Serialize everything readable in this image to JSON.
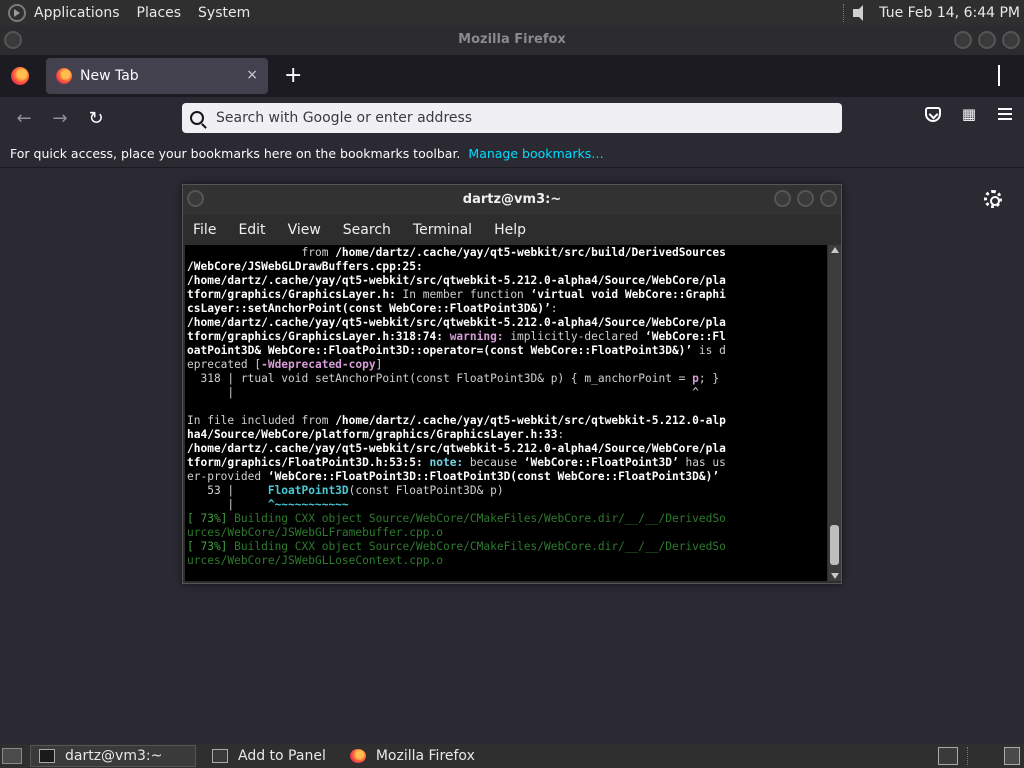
{
  "top_panel": {
    "menus": [
      "Applications",
      "Places",
      "System"
    ],
    "clock": "Tue Feb 14,  6:44 PM"
  },
  "firefox": {
    "window_title": "Mozilla Firefox",
    "tab": {
      "label": "New Tab",
      "close": "×"
    },
    "new_tab": "+",
    "urlbar_placeholder": "Search with Google or enter address",
    "bookmarks_text": "For quick access, place your bookmarks here on the bookmarks toolbar.",
    "manage_bookmarks": "Manage bookmarks…"
  },
  "terminal": {
    "title": "dartz@vm3:~",
    "menu": [
      "File",
      "Edit",
      "View",
      "Search",
      "Terminal",
      "Help"
    ],
    "lines": [
      [
        {
          "t": "                 from ",
          "c": ""
        },
        {
          "t": "/home/dartz/.cache/yay/qt5-webkit/src/build/DerivedSources",
          "c": "b"
        }
      ],
      [
        {
          "t": "/WebCore/JSWebGLDrawBuffers.cpp:25:",
          "c": "b"
        }
      ],
      [
        {
          "t": "/home/dartz/.cache/yay/qt5-webkit/src/qtwebkit-5.212.0-alpha4/Source/WebCore/pla",
          "c": "b"
        }
      ],
      [
        {
          "t": "tform/graphics/GraphicsLayer.h:",
          "c": "b"
        },
        {
          "t": " In member function ",
          "c": ""
        },
        {
          "t": "‘virtual void WebCore::Graphi",
          "c": "b"
        }
      ],
      [
        {
          "t": "csLayer::setAnchorPoint(const WebCore::FloatPoint3D&)’",
          "c": "b"
        },
        {
          "t": ":",
          "c": ""
        }
      ],
      [
        {
          "t": "/home/dartz/.cache/yay/qt5-webkit/src/qtwebkit-5.212.0-alpha4/Source/WebCore/pla",
          "c": "b"
        }
      ],
      [
        {
          "t": "tform/graphics/GraphicsLayer.h:318:74:",
          "c": "b"
        },
        {
          "t": " warning:",
          "c": "w"
        },
        {
          "t": " implicitly-declared ",
          "c": ""
        },
        {
          "t": "‘WebCore::Fl",
          "c": "b"
        }
      ],
      [
        {
          "t": "oatPoint3D& WebCore::FloatPoint3D::operator=(const WebCore::FloatPoint3D&)’",
          "c": "b"
        },
        {
          "t": " is d",
          "c": ""
        }
      ],
      [
        {
          "t": "eprecated [",
          "c": ""
        },
        {
          "t": "-Wdeprecated-copy",
          "c": "w"
        },
        {
          "t": "]",
          "c": ""
        }
      ],
      [
        {
          "t": "  318 | rtual void setAnchorPoint(const FloatPoint3D& p) { m_anchorPoint = ",
          "c": ""
        },
        {
          "t": "p",
          "c": "w"
        },
        {
          "t": "; }",
          "c": ""
        }
      ],
      [
        {
          "t": "      |                                                                    ^",
          "c": ""
        }
      ],
      [
        {
          "t": " ",
          "c": ""
        }
      ],
      [
        {
          "t": "In file included from ",
          "c": ""
        },
        {
          "t": "/home/dartz/.cache/yay/qt5-webkit/src/qtwebkit-5.212.0-alp",
          "c": "b"
        }
      ],
      [
        {
          "t": "ha4/Source/WebCore/platform/graphics/GraphicsLayer.h:33",
          "c": "b"
        },
        {
          "t": ":",
          "c": ""
        }
      ],
      [
        {
          "t": "/home/dartz/.cache/yay/qt5-webkit/src/qtwebkit-5.212.0-alpha4/Source/WebCore/pla",
          "c": "b"
        }
      ],
      [
        {
          "t": "tform/graphics/FloatPoint3D.h:53:5:",
          "c": "b"
        },
        {
          "t": " note:",
          "c": "n"
        },
        {
          "t": " because ",
          "c": ""
        },
        {
          "t": "‘WebCore::FloatPoint3D’",
          "c": "b"
        },
        {
          "t": " has us",
          "c": ""
        }
      ],
      [
        {
          "t": "er-provided ",
          "c": ""
        },
        {
          "t": "‘WebCore::FloatPoint3D::FloatPoint3D(const WebCore::FloatPoint3D&)’",
          "c": "b"
        }
      ],
      [
        {
          "t": "   53 |     ",
          "c": ""
        },
        {
          "t": "FloatPoint3D",
          "c": "c"
        },
        {
          "t": "(const FloatPoint3D& p)",
          "c": ""
        }
      ],
      [
        {
          "t": "      |     ",
          "c": ""
        },
        {
          "t": "^~~~~~~~~~~~",
          "c": "c"
        }
      ],
      [
        {
          "t": "[ 73%] ",
          "c": "g"
        },
        {
          "t": "Building CXX object Source/WebCore/CMakeFiles/WebCore.dir/__/__/DerivedSo",
          "c": "g2"
        }
      ],
      [
        {
          "t": "urces/WebCore/JSWebGLFramebuffer.cpp.o",
          "c": "g2"
        }
      ],
      [
        {
          "t": "[ 73%] ",
          "c": "g"
        },
        {
          "t": "Building CXX object Source/WebCore/CMakeFiles/WebCore.dir/__/__/DerivedSo",
          "c": "g2"
        }
      ],
      [
        {
          "t": "urces/WebCore/JSWebGLLoseContext.cpp.o",
          "c": "g2"
        }
      ]
    ]
  },
  "bottom_panel": {
    "tasks": [
      "dartz@vm3:~",
      "Add to Panel",
      "Mozilla Firefox"
    ]
  }
}
